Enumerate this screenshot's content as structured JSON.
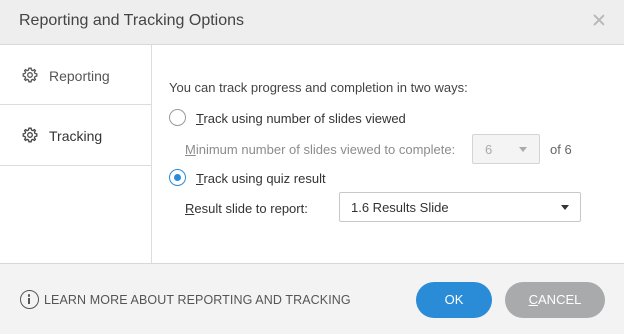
{
  "dialog": {
    "title": "Reporting and Tracking Options"
  },
  "sidebar": {
    "items": [
      {
        "label": "Reporting",
        "icon": "gear-icon",
        "selected": false
      },
      {
        "label": "Tracking",
        "icon": "gear-icon",
        "selected": true
      }
    ]
  },
  "tracking": {
    "intro": "You can track progress and completion in two ways:",
    "option_slides": {
      "mnemonic": "T",
      "rest": "rack using number of slides viewed",
      "checked": false
    },
    "minimum": {
      "mnemonic": "M",
      "rest": "inimum number of slides viewed to complete:",
      "value": "6",
      "of_text": "of 6",
      "disabled": true
    },
    "option_quiz": {
      "mnemonic": "T",
      "rest": "rack using quiz result",
      "checked": true
    },
    "result": {
      "mnemonic": "R",
      "rest": "esult slide to report:",
      "value": "1.6 Results Slide"
    }
  },
  "footer": {
    "learn_more": "LEARN MORE ABOUT REPORTING AND TRACKING",
    "ok_label": "OK",
    "cancel_mnemonic": "C",
    "cancel_rest": "ANCEL"
  },
  "colors": {
    "accent": "#2a8bd6",
    "cancel_bg": "#a8aaab"
  }
}
